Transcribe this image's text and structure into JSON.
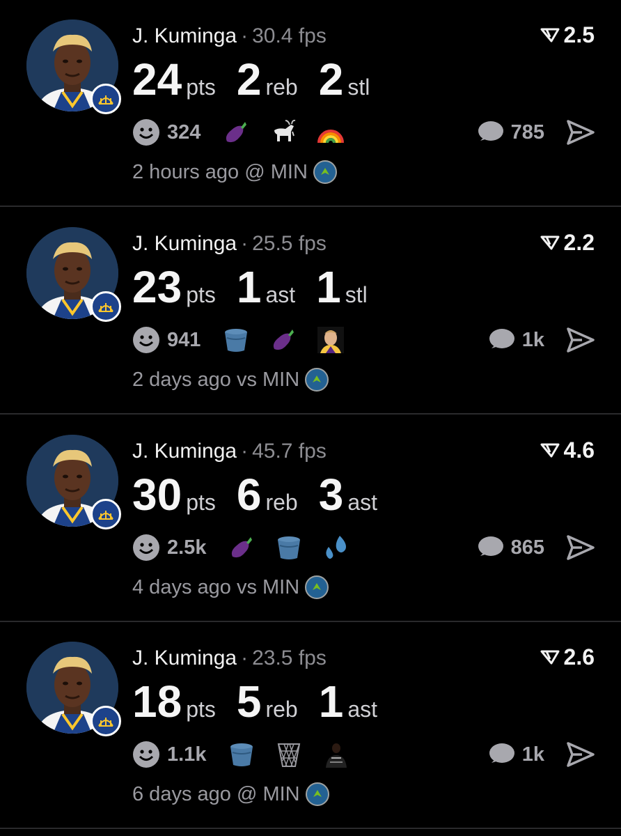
{
  "feed": {
    "posts": [
      {
        "player": "J. Kuminga",
        "separator": "·",
        "fps": "30.4 fps",
        "rating": "2.5",
        "stats": [
          {
            "num": "24",
            "unit": "pts"
          },
          {
            "num": "2",
            "unit": "reb"
          },
          {
            "num": "2",
            "unit": "stl"
          }
        ],
        "reaction_count": "324",
        "emojis": [
          "eggplant-icon",
          "goat-icon",
          "rainbow-icon"
        ],
        "comment_count": "785",
        "time": "2 hours ago @ MIN"
      },
      {
        "player": "J. Kuminga",
        "separator": "·",
        "fps": "25.5 fps",
        "rating": "2.2",
        "stats": [
          {
            "num": "23",
            "unit": "pts"
          },
          {
            "num": "1",
            "unit": "ast"
          },
          {
            "num": "1",
            "unit": "stl"
          }
        ],
        "reaction_count": "941",
        "emojis": [
          "bucket-icon",
          "eggplant-icon",
          "player-face-icon"
        ],
        "comment_count": "1k",
        "time": "2 days ago vs MIN"
      },
      {
        "player": "J. Kuminga",
        "separator": "·",
        "fps": "45.7 fps",
        "rating": "4.6",
        "stats": [
          {
            "num": "30",
            "unit": "pts"
          },
          {
            "num": "6",
            "unit": "reb"
          },
          {
            "num": "3",
            "unit": "ast"
          }
        ],
        "reaction_count": "2.5k",
        "emojis": [
          "eggplant-icon",
          "bucket-icon",
          "sweat-drops-icon"
        ],
        "comment_count": "865",
        "time": "4 days ago vs MIN"
      },
      {
        "player": "J. Kuminga",
        "separator": "·",
        "fps": "23.5 fps",
        "rating": "2.6",
        "stats": [
          {
            "num": "18",
            "unit": "pts"
          },
          {
            "num": "5",
            "unit": "reb"
          },
          {
            "num": "1",
            "unit": "ast"
          }
        ],
        "reaction_count": "1.1k",
        "emojis": [
          "bucket-icon",
          "basketball-net-icon",
          "player-jersey-icon"
        ],
        "comment_count": "1k",
        "time": "6 days ago @ MIN"
      }
    ]
  },
  "colors": {
    "background": "#000000",
    "muted_text": "#9a9aa0",
    "divider": "#2a2a2c",
    "warriors_blue": "#1d428a",
    "warriors_gold": "#ffc72c",
    "wolves_blue": "#236192"
  }
}
